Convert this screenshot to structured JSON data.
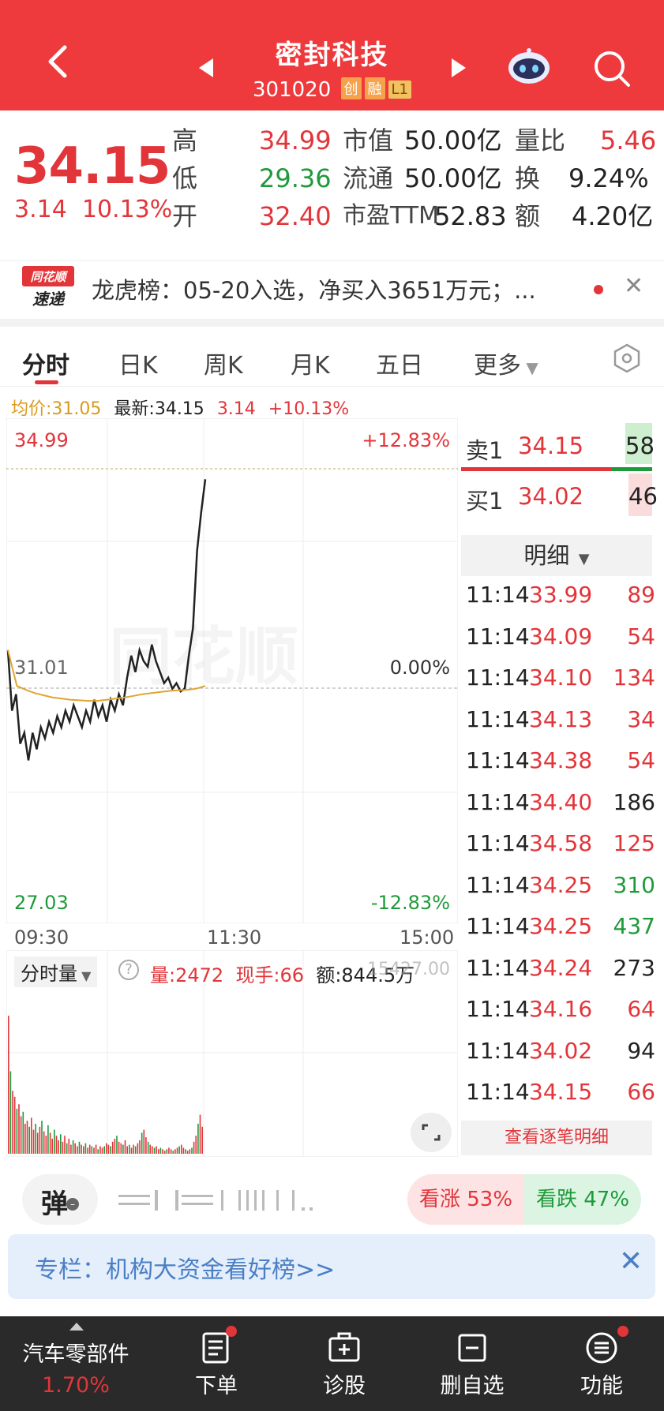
{
  "header": {
    "title": "密封科技",
    "code": "301020",
    "tags": [
      "创",
      "融",
      "L1"
    ]
  },
  "quote": {
    "price": "34.15",
    "change": "3.14",
    "change_pct": "10.13%",
    "high_label": "高",
    "high": "34.99",
    "low_label": "低",
    "low": "29.36",
    "open_label": "开",
    "open": "32.40",
    "mktcap_label": "市值",
    "mktcap": "50.00亿",
    "float_label": "流通",
    "float": "50.00亿",
    "pe_label": "市盈TTM",
    "pe": "52.83",
    "volratio_label": "量比",
    "volratio": "5.46",
    "turnover_label": "换",
    "turnover": "9.24%",
    "amount_label": "额",
    "amount": "4.20亿"
  },
  "news": {
    "logo_top": "同花顺",
    "logo_bottom": "速递",
    "text": "龙虎榜：05-20入选，净买入3651万元；..."
  },
  "tabs": [
    "分时",
    "日K",
    "周K",
    "月K",
    "五日",
    "更多"
  ],
  "info": {
    "avg": "均价:31.05",
    "latest": "最新:34.15",
    "chg": "3.14",
    "pct": "+10.13%"
  },
  "chart": {
    "y_top": "34.99",
    "y_mid": "31.01",
    "y_bot": "27.03",
    "pct_top": "+12.83%",
    "pct_mid": "0.00%",
    "pct_bot": "-12.83%",
    "x_start": "09:30",
    "x_mid": "11:30",
    "x_end": "15:00",
    "watermark": "同花顺"
  },
  "chart_data": {
    "type": "line",
    "x_range": [
      "09:30",
      "15:00"
    ],
    "ylim": [
      27.03,
      34.99
    ],
    "prev_close": 31.01,
    "series": [
      {
        "values": [
          31.7,
          30.6,
          30.9,
          30.0,
          30.2,
          29.7,
          30.2,
          29.9,
          30.3,
          30.1,
          30.4,
          30.2,
          30.5,
          30.3,
          30.6,
          30.4,
          30.7,
          30.5,
          30.3,
          30.6,
          30.4,
          30.8,
          30.5,
          30.7,
          30.4,
          30.8,
          30.6,
          30.9,
          30.7,
          31.2,
          31.6,
          31.3,
          31.7,
          31.5,
          31.4,
          31.8,
          31.5,
          31.3,
          31.1,
          31.2,
          31.0,
          31.1,
          30.95,
          31.0,
          31.6,
          32.1,
          33.5,
          34.2,
          34.8
        ]
      },
      {
        "values": [
          31.7,
          31.05,
          30.98,
          30.92,
          30.88,
          30.84,
          30.82,
          30.8,
          30.79,
          30.78,
          30.78,
          30.8,
          30.82,
          30.84,
          30.87,
          30.9,
          30.92,
          30.94,
          30.96,
          30.97,
          30.98,
          31.0,
          31.05
        ]
      }
    ]
  },
  "volume": {
    "label": "分时量",
    "qty": "量:2472",
    "hand": "现手:66",
    "amt": "额:844.5万",
    "vol_max": "15427.00"
  },
  "orderbook": {
    "sell_label": "卖1",
    "sell_price": "34.15",
    "sell_vol": "58",
    "buy_label": "买1",
    "buy_price": "34.02",
    "buy_vol": "46",
    "detail_label": "明细",
    "trades": [
      {
        "t": "11:14",
        "p": "33.99",
        "v": "89",
        "c": "red"
      },
      {
        "t": "11:14",
        "p": "34.09",
        "v": "54",
        "c": "red"
      },
      {
        "t": "11:14",
        "p": "34.10",
        "v": "134",
        "c": "red"
      },
      {
        "t": "11:14",
        "p": "34.13",
        "v": "34",
        "c": "red"
      },
      {
        "t": "11:14",
        "p": "34.38",
        "v": "54",
        "c": "red"
      },
      {
        "t": "11:14",
        "p": "34.40",
        "v": "186",
        "c": "black"
      },
      {
        "t": "11:14",
        "p": "34.58",
        "v": "125",
        "c": "red"
      },
      {
        "t": "11:14",
        "p": "34.25",
        "v": "310",
        "c": "green"
      },
      {
        "t": "11:14",
        "p": "34.25",
        "v": "437",
        "c": "green"
      },
      {
        "t": "11:14",
        "p": "34.24",
        "v": "273",
        "c": "black"
      },
      {
        "t": "11:14",
        "p": "34.16",
        "v": "64",
        "c": "red"
      },
      {
        "t": "11:14",
        "p": "34.02",
        "v": "94",
        "c": "black"
      },
      {
        "t": "11:14",
        "p": "34.15",
        "v": "66",
        "c": "red"
      }
    ],
    "detail_link": "查看逐笔明细"
  },
  "bottom": {
    "danmu": "弹",
    "vote_up": "看涨 53%",
    "vote_down": "看跌 47%",
    "column": "专栏：机构大资金看好榜>>"
  },
  "nav": {
    "sector": "汽车零部件",
    "sector_pct": "1.70%",
    "order": "下单",
    "diagnose": "诊股",
    "delete": "删自选",
    "func": "功能"
  },
  "colors": {
    "accent": "#ee3a3d",
    "up": "#e2353a",
    "down": "#1f9a3a",
    "avg_line": "#e0a531"
  }
}
